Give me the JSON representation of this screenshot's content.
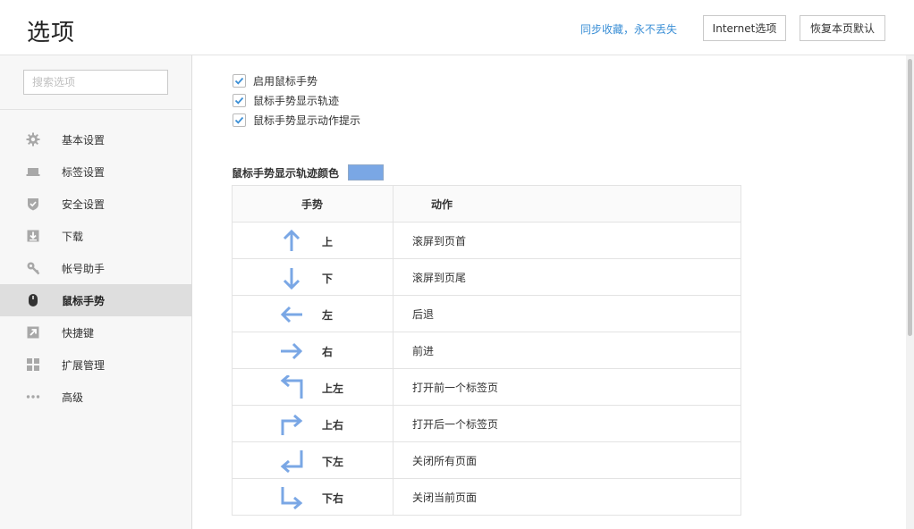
{
  "header": {
    "title": "选项",
    "sync_link": "同步收藏，永不丢失",
    "internet_options_button": "Internet选项",
    "reset_button": "恢复本页默认"
  },
  "sidebar": {
    "search_placeholder": "搜索选项",
    "items": [
      {
        "label": "基本设置",
        "icon": "gear-icon"
      },
      {
        "label": "标签设置",
        "icon": "tab-icon"
      },
      {
        "label": "安全设置",
        "icon": "shield-icon"
      },
      {
        "label": "下载",
        "icon": "download-icon"
      },
      {
        "label": "帐号助手",
        "icon": "key-icon"
      },
      {
        "label": "鼠标手势",
        "icon": "mouse-icon",
        "active": true
      },
      {
        "label": "快捷键",
        "icon": "shortcut-icon"
      },
      {
        "label": "扩展管理",
        "icon": "extensions-icon"
      },
      {
        "label": "高级",
        "icon": "more-icon"
      }
    ]
  },
  "main": {
    "checkboxes": [
      {
        "label": "启用鼠标手势",
        "checked": true
      },
      {
        "label": "鼠标手势显示轨迹",
        "checked": true
      },
      {
        "label": "鼠标手势显示动作提示",
        "checked": true
      }
    ],
    "trail_color_label": "鼠标手势显示轨迹颜色",
    "trail_color": "#7aa7e5",
    "table": {
      "headers": [
        "手势",
        "动作"
      ],
      "rows": [
        {
          "gesture": "上",
          "action": "滚屏到页首",
          "icon": "arrow-up-icon"
        },
        {
          "gesture": "下",
          "action": "滚屏到页尾",
          "icon": "arrow-down-icon"
        },
        {
          "gesture": "左",
          "action": "后退",
          "icon": "arrow-left-icon"
        },
        {
          "gesture": "右",
          "action": "前进",
          "icon": "arrow-right-icon"
        },
        {
          "gesture": "上左",
          "action": "打开前一个标签页",
          "icon": "arrow-up-left-icon"
        },
        {
          "gesture": "上右",
          "action": "打开后一个标签页",
          "icon": "arrow-up-right-icon"
        },
        {
          "gesture": "下左",
          "action": "关闭所有页面",
          "icon": "arrow-down-left-icon"
        },
        {
          "gesture": "下右",
          "action": "关闭当前页面",
          "icon": "arrow-down-right-icon"
        }
      ]
    }
  },
  "colors": {
    "accent": "#3b8fd6",
    "arrow": "#7aa7e5",
    "sidebar_bg": "#f7f7f7",
    "active_bg": "#dedede"
  }
}
